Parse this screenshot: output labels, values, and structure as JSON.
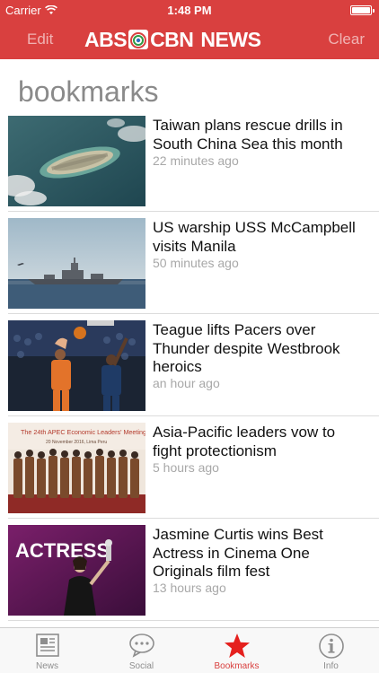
{
  "status_bar": {
    "carrier": "Carrier",
    "time": "1:48 PM",
    "battery_level": 1.0
  },
  "nav": {
    "edit_label": "Edit",
    "clear_label": "Clear",
    "logo_left": "ABS",
    "logo_right": "CBN",
    "logo_news": "NEWS",
    "accent_color": "#d9403f"
  },
  "page": {
    "title": "bookmarks"
  },
  "bookmarks": [
    {
      "headline": "Taiwan plans rescue drills in South China Sea this month",
      "age": "22 minutes ago",
      "image": "island-aerial-photo"
    },
    {
      "headline": "US warship USS McCampbell visits Manila",
      "age": "50 minutes ago",
      "image": "warship-photo"
    },
    {
      "headline": "Teague lifts Pacers over Thunder despite Westbrook heroics",
      "age": "an hour ago",
      "image": "basketball-photo"
    },
    {
      "headline": "Asia-Pacific leaders vow to fight protectionism",
      "age": "5 hours ago",
      "image": "apec-leaders-photo",
      "image_caption_line1": "The 24th APEC Economic Leaders' Meeting",
      "image_caption_line2": "20 November 2016, Lima Peru"
    },
    {
      "headline": "Jasmine Curtis wins Best Actress in Cinema One Originals film fest",
      "age": "13 hours ago",
      "image": "actress-award-photo",
      "image_text": "ACTRESS"
    }
  ],
  "tabs": [
    {
      "label": "News",
      "icon": "newspaper-icon",
      "active": false
    },
    {
      "label": "Social",
      "icon": "speech-bubble-icon",
      "active": false
    },
    {
      "label": "Bookmarks",
      "icon": "star-icon",
      "active": true
    },
    {
      "label": "Info",
      "icon": "info-icon",
      "active": false
    }
  ]
}
